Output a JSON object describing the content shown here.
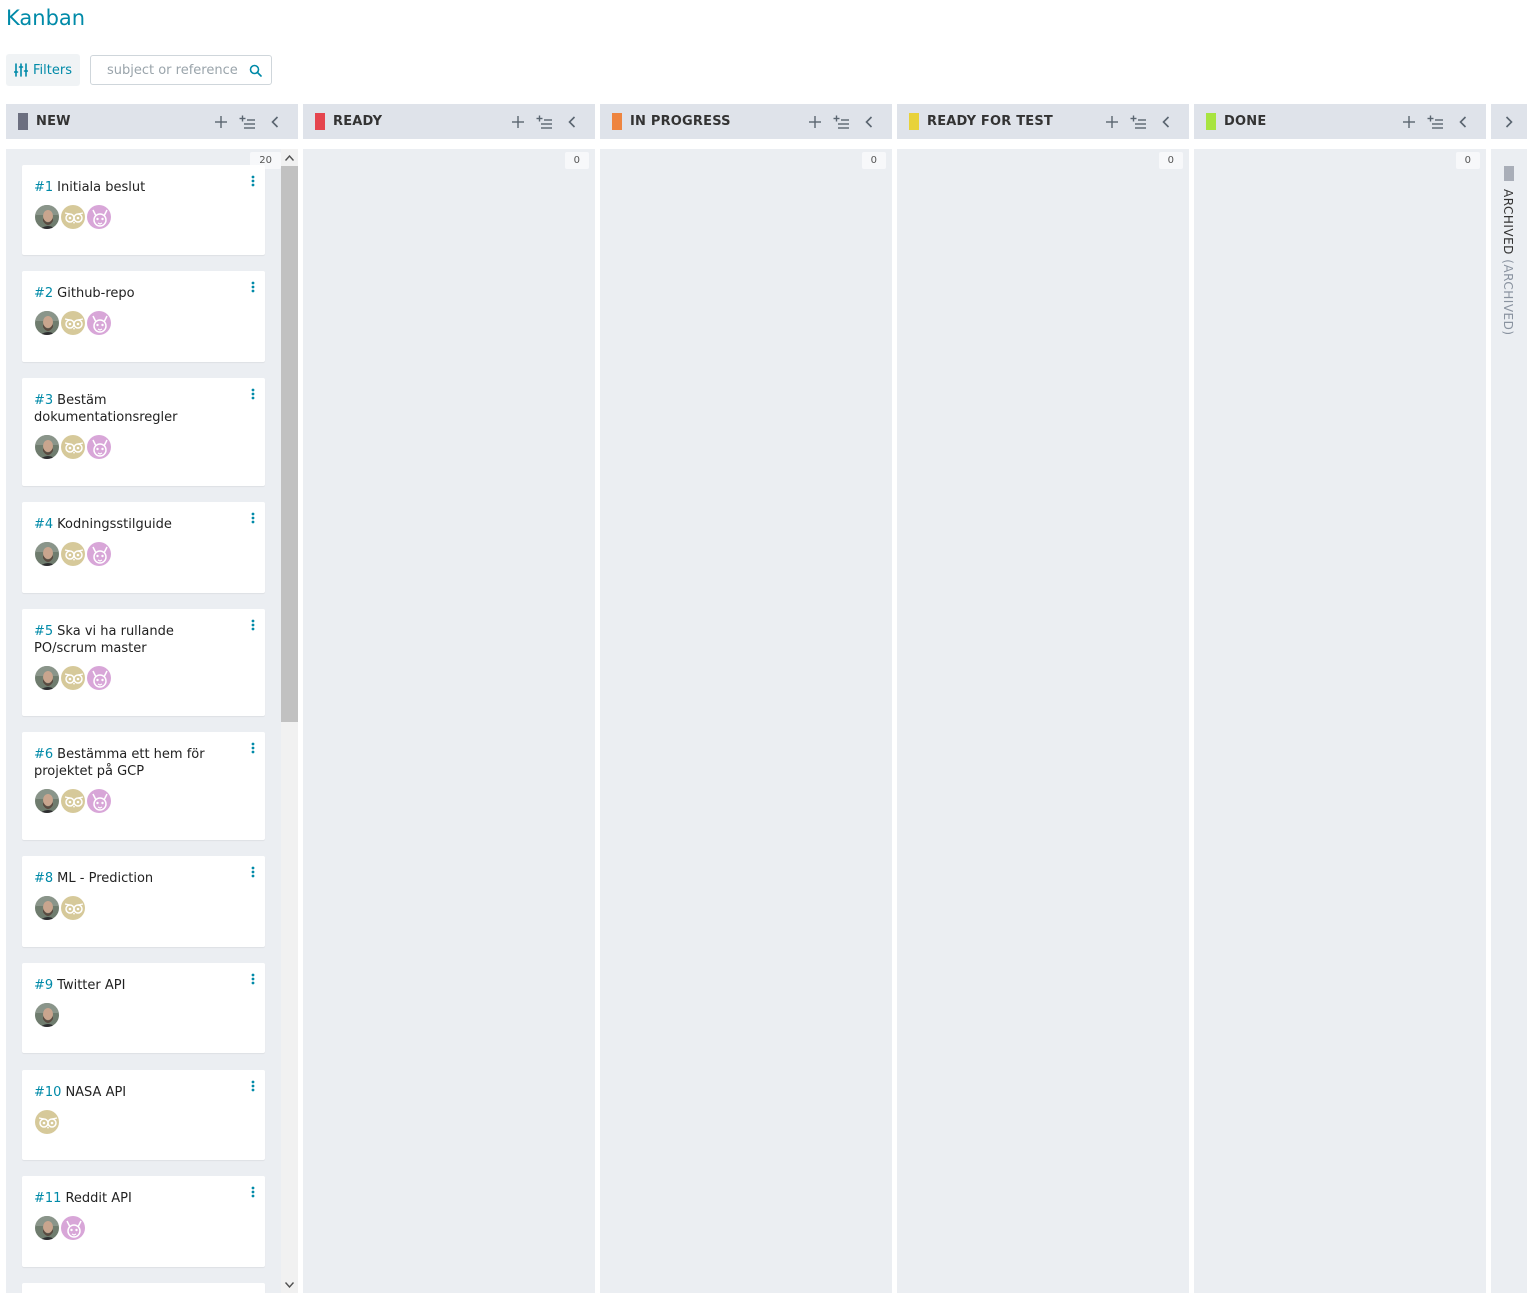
{
  "page": {
    "title": "Kanban"
  },
  "toolbar": {
    "filters_label": "Filters",
    "search_placeholder": "subject or reference"
  },
  "columns": [
    {
      "name": "NEW",
      "color": "#6c6f80",
      "count": "20"
    },
    {
      "name": "READY",
      "color": "#e5454e",
      "count": "0"
    },
    {
      "name": "IN PROGRESS",
      "color": "#ee8540",
      "count": "0"
    },
    {
      "name": "READY FOR TEST",
      "color": "#e8d23a",
      "count": "0"
    },
    {
      "name": "DONE",
      "color": "#a8e440",
      "count": "0"
    }
  ],
  "archived": {
    "label": "ARCHIVED",
    "sub": "(ARCHIVED)",
    "color": "#a9aeb8"
  },
  "cards": [
    {
      "ref": "#1",
      "title": "Initiala beslut",
      "avatars": [
        "person",
        "owl",
        "cat"
      ]
    },
    {
      "ref": "#2",
      "title": "Github-repo",
      "avatars": [
        "person",
        "owl",
        "cat"
      ]
    },
    {
      "ref": "#3",
      "title": "Bestäm dokumentationsregler",
      "avatars": [
        "person",
        "owl",
        "cat"
      ]
    },
    {
      "ref": "#4",
      "title": "Kodningsstilguide",
      "avatars": [
        "person",
        "owl",
        "cat"
      ]
    },
    {
      "ref": "#5",
      "title": "Ska vi ha rullande PO/scrum master",
      "avatars": [
        "person",
        "owl",
        "cat"
      ]
    },
    {
      "ref": "#6",
      "title": "Bestämma ett hem för projektet på GCP",
      "avatars": [
        "person",
        "owl",
        "cat"
      ]
    },
    {
      "ref": "#8",
      "title": "ML - Prediction",
      "avatars": [
        "person",
        "owl"
      ]
    },
    {
      "ref": "#9",
      "title": "Twitter API",
      "avatars": [
        "person"
      ]
    },
    {
      "ref": "#10",
      "title": "NASA API",
      "avatars": [
        "owl"
      ]
    },
    {
      "ref": "#11",
      "title": "Reddit API",
      "avatars": [
        "person",
        "cat"
      ]
    }
  ],
  "icons": {
    "filters": "sliders-icon",
    "search": "search-icon",
    "add": "plus-icon",
    "bulk_add": "add-list-icon",
    "fold": "chevron-left-icon",
    "unfold_archived": "chevron-right-icon",
    "card_menu": "more-vertical-icon"
  },
  "brand_color": "#008aa8"
}
